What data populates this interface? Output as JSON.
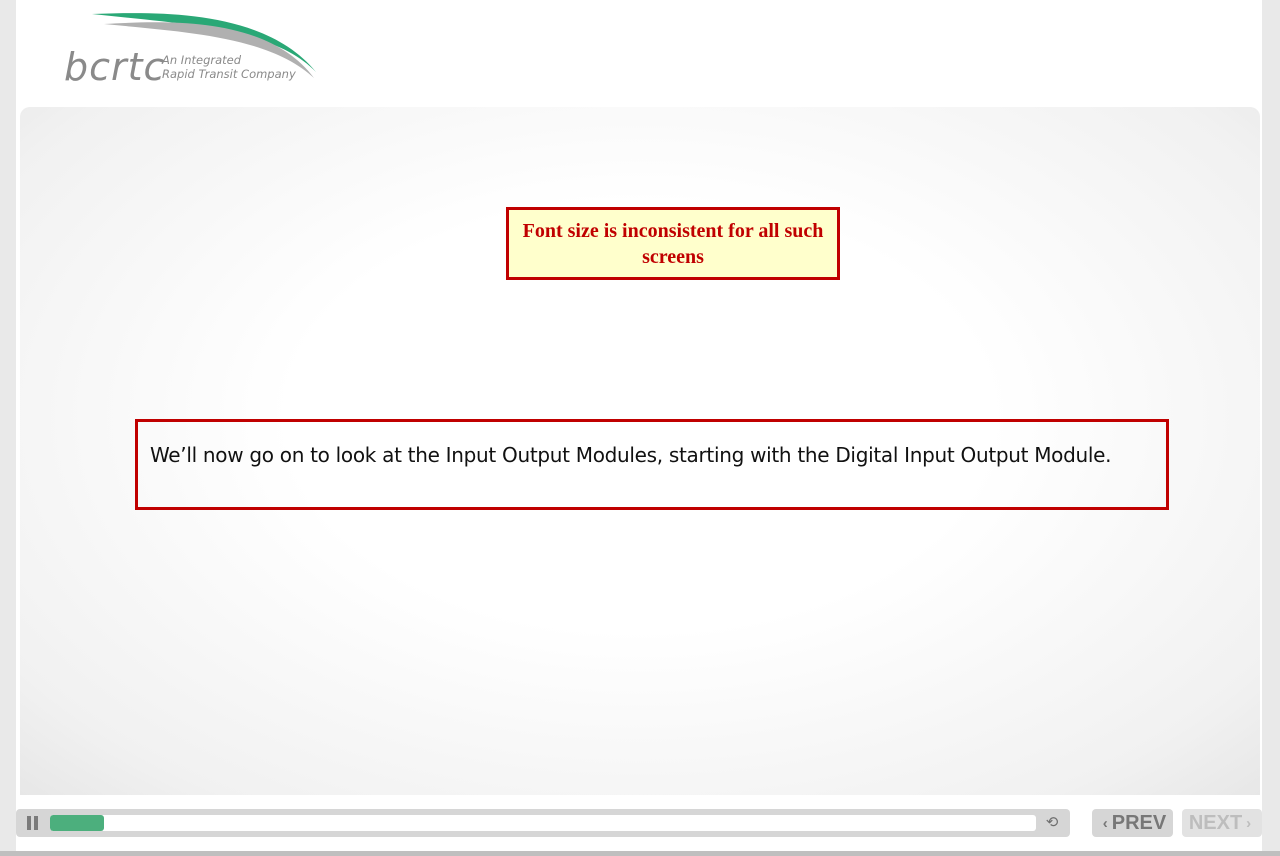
{
  "logo": {
    "wordmark": "bcrtc",
    "tagline_line1": "An Integrated",
    "tagline_line2": "Rapid Transit Company",
    "colors": {
      "swoosh_green": "#2aa876",
      "swoosh_gray": "#b0b0b0"
    }
  },
  "slide": {
    "review_note": "Font size is inconsistent for all such screens",
    "body_text": "We’ll now go on to look at the Input Output Modules, starting with the Digital Input Output Module."
  },
  "playbar": {
    "progress_fraction": 0.055,
    "pause_icon": "pause-icon",
    "replay_icon": "replay-icon"
  },
  "nav": {
    "prev_label": "PREV",
    "next_label": "NEXT"
  },
  "colors": {
    "accent_red": "#c00000",
    "note_background": "#ffffcc",
    "progress_fill": "#4caf7d"
  }
}
